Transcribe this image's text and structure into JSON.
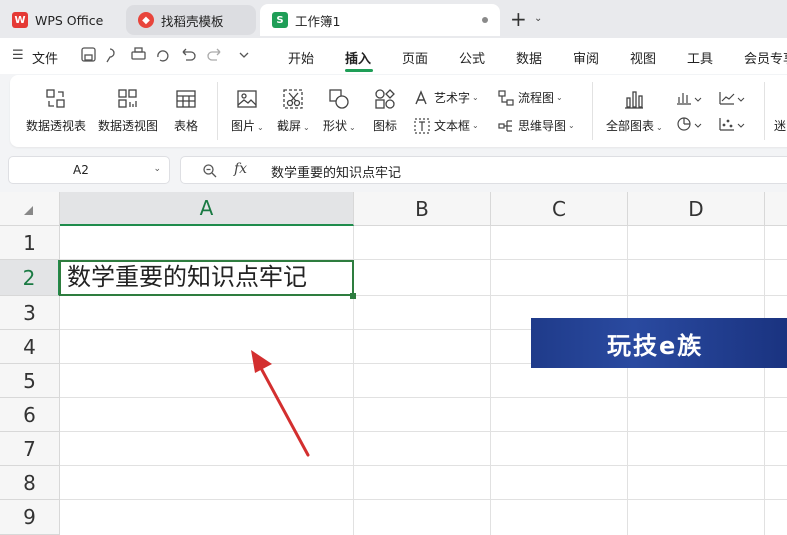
{
  "tabs": {
    "wps": "WPS Office",
    "template": "找稻壳模板",
    "workbook": "工作簿1",
    "workbook_icon": "S"
  },
  "menu": {
    "file": "文件",
    "items": [
      "开始",
      "插入",
      "页面",
      "公式",
      "数据",
      "审阅",
      "视图",
      "工具",
      "会员专享"
    ],
    "active": "插入"
  },
  "ribbon": {
    "pivot_table": "数据透视表",
    "pivot_chart": "数据透视图",
    "table": "表格",
    "picture": "图片",
    "screenshot": "截屏",
    "shape": "形状",
    "icon": "图标",
    "wordart": "艺术字",
    "textbox": "文本框",
    "flowchart": "流程图",
    "mindmap": "思维导图",
    "all_charts": "全部图表",
    "more": "迷"
  },
  "formula_bar": {
    "name_box": "A2",
    "fx": "fx",
    "content": "数学重要的知识点牢记"
  },
  "grid": {
    "columns": [
      "A",
      "B",
      "C",
      "D"
    ],
    "selected_column": "A",
    "rows": [
      "1",
      "2",
      "3",
      "4",
      "5",
      "6",
      "7",
      "8",
      "9"
    ],
    "selected_row": "2",
    "cell_a2": "数学重要的知识点牢记"
  },
  "watermark": {
    "text": "玩技e族"
  },
  "colors": {
    "accent": "#1f9e57",
    "selection": "#2e7d3f",
    "arrow": "#d32f2f",
    "watermark_bg": "#1f3b8a"
  }
}
